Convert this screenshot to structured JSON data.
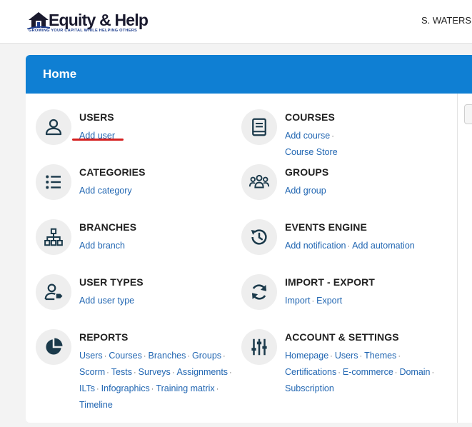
{
  "header": {
    "logo_title": "Equity & Help",
    "logo_tagline": "GROWING YOUR CAPITAL WHILE HELPING OTHERS",
    "user_name": "S. WATERS |"
  },
  "panel": {
    "title": "Home"
  },
  "items": [
    {
      "title": "USERS",
      "icon": "user-icon",
      "links": [
        "Add user"
      ]
    },
    {
      "title": "COURSES",
      "icon": "book-icon",
      "links": [
        "Add course",
        "Course Store"
      ]
    },
    {
      "title": "CATEGORIES",
      "icon": "list-icon",
      "links": [
        "Add category"
      ]
    },
    {
      "title": "GROUPS",
      "icon": "group-icon",
      "links": [
        "Add group"
      ]
    },
    {
      "title": "BRANCHES",
      "icon": "sitemap-icon",
      "links": [
        "Add branch"
      ]
    },
    {
      "title": "EVENTS ENGINE",
      "icon": "history-icon",
      "links": [
        "Add notification",
        "Add automation"
      ]
    },
    {
      "title": "USER TYPES",
      "icon": "user-tag-icon",
      "links": [
        "Add user type"
      ]
    },
    {
      "title": "IMPORT - EXPORT",
      "icon": "sync-icon",
      "links": [
        "Import",
        "Export"
      ]
    },
    {
      "title": "REPORTS",
      "icon": "pie-chart-icon",
      "links": [
        "Users",
        "Courses",
        "Branches",
        "Groups",
        "Scorm",
        "Tests",
        "Surveys",
        "Assignments",
        "ILTs",
        "Infographics",
        "Training matrix",
        "Timeline"
      ]
    },
    {
      "title": "ACCOUNT & SETTINGS",
      "icon": "sliders-icon",
      "links": [
        "Homepage",
        "Users",
        "Themes",
        "Certifications",
        "E-commerce",
        "Domain",
        "Subscription"
      ]
    }
  ],
  "colors": {
    "header_blue": "#0f7fd3",
    "link_blue": "#2166b2",
    "icon_dark": "#1b3a4b",
    "annotation_red": "#d51f1f"
  }
}
